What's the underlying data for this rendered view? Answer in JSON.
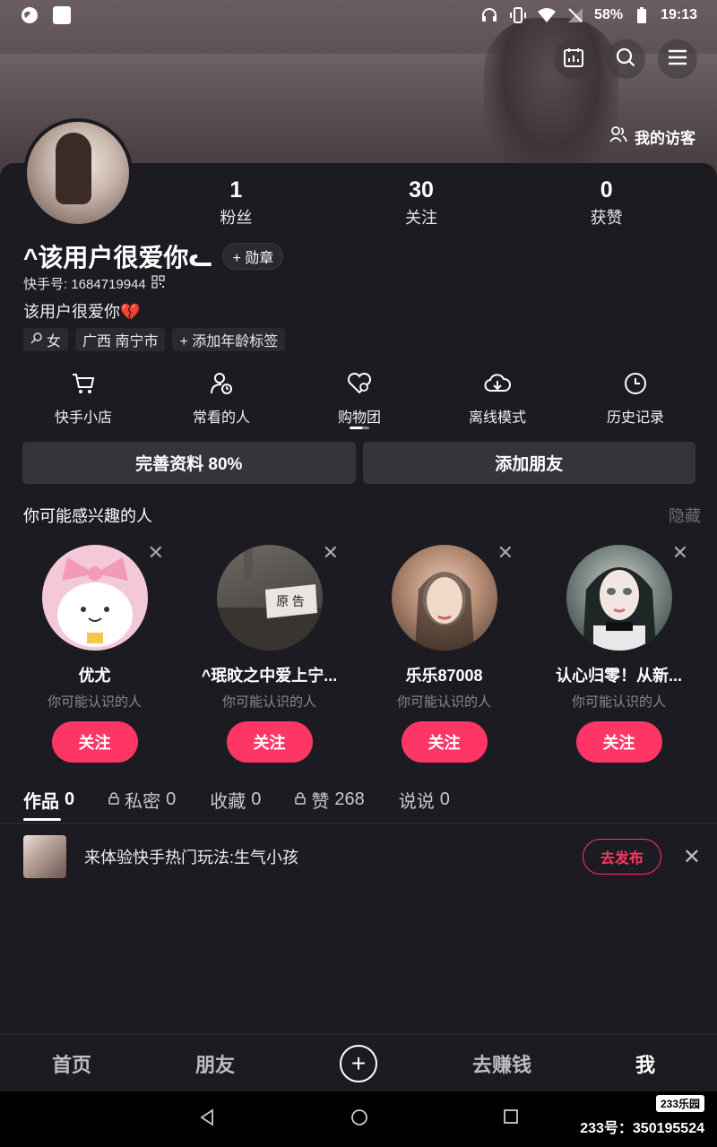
{
  "status_bar": {
    "battery": "58%",
    "time": "19:13"
  },
  "header": {
    "visitors_label": "我的访客"
  },
  "profile": {
    "stats": [
      {
        "value": "1",
        "label": "粉丝"
      },
      {
        "value": "30",
        "label": "关注"
      },
      {
        "value": "0",
        "label": "获赞"
      }
    ],
    "name": "^该用户很爱你ᓚ",
    "badge_label": "+ 勋章",
    "uid": "快手号: 1684719944",
    "bio": "该用户很爱你💔",
    "tags": [
      "女",
      "广西 南宁市",
      "+ 添加年龄标签"
    ]
  },
  "shortcuts": [
    "快手小店",
    "常看的人",
    "购物团",
    "离线模式",
    "历史记录"
  ],
  "actions": {
    "complete_profile": "完善资料 80%",
    "add_friend": "添加朋友"
  },
  "recommend": {
    "title": "你可能感兴趣的人",
    "hide_label": "隐藏",
    "people": [
      {
        "name": "优尤",
        "sub": "你可能认识的人",
        "follow": "关注"
      },
      {
        "name": "^珉旼之中爱上宁...",
        "sub": "你可能认识的人",
        "follow": "关注"
      },
      {
        "name": "乐乐87008",
        "sub": "你可能认识的人",
        "follow": "关注"
      },
      {
        "name": "认心归零！从新...",
        "sub": "你可能认识的人",
        "follow": "关注"
      }
    ],
    "plaque_text": "原 告"
  },
  "tabs": [
    {
      "label": "作品",
      "count": "0"
    },
    {
      "label": "私密",
      "count": "0"
    },
    {
      "label": "收藏",
      "count": "0"
    },
    {
      "label": "赞",
      "count": "268"
    },
    {
      "label": "说说",
      "count": "0"
    }
  ],
  "promo": {
    "text": "来体验快手热门玩法:生气小孩",
    "button": "去发布"
  },
  "bottom_nav": {
    "home": "首页",
    "friends": "朋友",
    "earn": "去赚钱",
    "me": "我"
  },
  "watermark": {
    "logo": "233乐园",
    "text": "233号：350195524"
  }
}
